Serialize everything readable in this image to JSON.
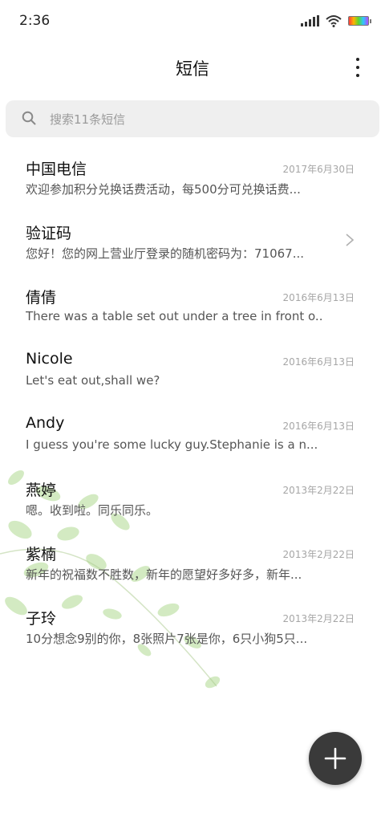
{
  "status": {
    "time": "2:36",
    "icons": [
      "signal-icon",
      "wifi-icon",
      "battery-icon"
    ]
  },
  "header": {
    "title": "短信",
    "more_icon": "more-vertical-icon"
  },
  "search": {
    "placeholder": "搜索11条短信",
    "icon": "search-icon"
  },
  "messages": [
    {
      "name": "中国电信",
      "date": "2017年6月30日",
      "preview": "欢迎参加积分兑换话费活动，每500分可兑换话费..."
    },
    {
      "name": "验证码",
      "date": "",
      "preview": "您好！您的网上营业厅登录的随机密码为：71067..."
    },
    {
      "name": "倩倩",
      "date": "2016年6月13日",
      "preview": "There was a table set out under a tree in front o..."
    },
    {
      "name": "Nicole",
      "date": "2016年6月13日",
      "preview": "Let's eat out,shall we?"
    },
    {
      "name": "Andy",
      "date": "2016年6月13日",
      "preview": "I guess you're some lucky guy.Stephanie is a n..."
    },
    {
      "name": "燕婷",
      "date": "2013年2月22日",
      "preview": "嗯。收到啦。同乐同乐。"
    },
    {
      "name": "紫楠",
      "date": "2013年2月22日",
      "preview": "新年的祝福数不胜数，新年的愿望好多好多，新年..."
    },
    {
      "name": "子玲",
      "date": "2013年2月22日",
      "preview": "10分想念9别的你，8张照片7张是你，6只小狗5只..."
    }
  ],
  "fab": {
    "icon": "plus-icon"
  },
  "colors": {
    "fab": "#3a3a3a",
    "search_bg": "#efefef"
  }
}
